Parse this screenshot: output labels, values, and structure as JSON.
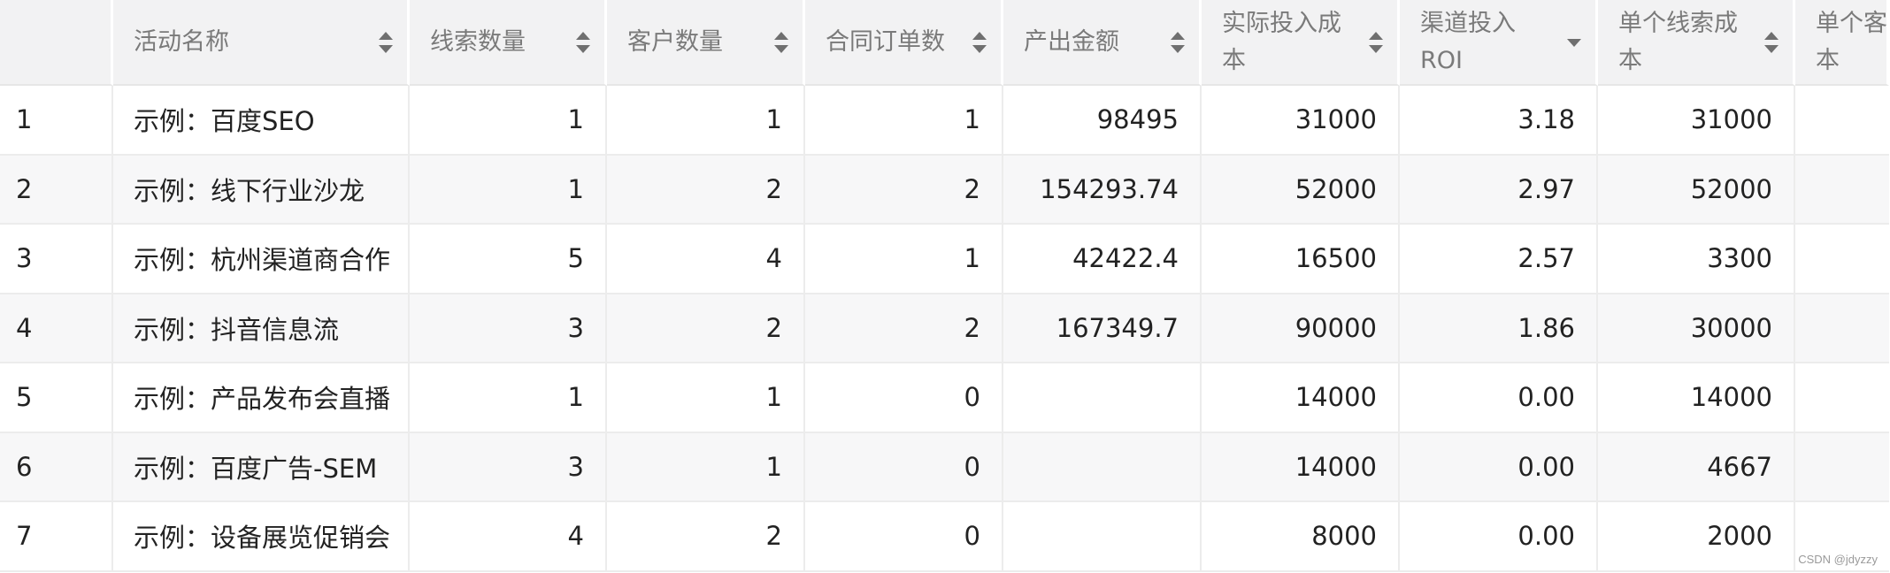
{
  "table": {
    "headers": [
      {
        "lines": [
          ""
        ],
        "sort": "none"
      },
      {
        "lines": [
          "活动名称"
        ],
        "sort": "both"
      },
      {
        "lines": [
          "线索数量"
        ],
        "sort": "both"
      },
      {
        "lines": [
          "客户数量"
        ],
        "sort": "both"
      },
      {
        "lines": [
          "合同订单数"
        ],
        "sort": "both"
      },
      {
        "lines": [
          "产出金额"
        ],
        "sort": "both"
      },
      {
        "lines": [
          "实际投入成",
          "本"
        ],
        "sort": "both"
      },
      {
        "lines": [
          "渠道投入",
          "ROI"
        ],
        "sort": "desc"
      },
      {
        "lines": [
          "单个线索成",
          "本"
        ],
        "sort": "both"
      },
      {
        "lines": [
          "单个客",
          "本"
        ],
        "sort": "none"
      }
    ],
    "rows": [
      [
        "1",
        "示例：百度SEO",
        "1",
        "1",
        "1",
        "98495",
        "31000",
        "3.18",
        "31000",
        ""
      ],
      [
        "2",
        "示例：线下行业沙龙",
        "1",
        "2",
        "2",
        "154293.74",
        "52000",
        "2.97",
        "52000",
        ""
      ],
      [
        "3",
        "示例：杭州渠道商合作",
        "5",
        "4",
        "1",
        "42422.4",
        "16500",
        "2.57",
        "3300",
        ""
      ],
      [
        "4",
        "示例：抖音信息流",
        "3",
        "2",
        "2",
        "167349.7",
        "90000",
        "1.86",
        "30000",
        ""
      ],
      [
        "5",
        "示例：产品发布会直播",
        "1",
        "1",
        "0",
        "",
        "14000",
        "0.00",
        "14000",
        ""
      ],
      [
        "6",
        "示例：百度广告-SEM",
        "3",
        "1",
        "0",
        "",
        "14000",
        "0.00",
        "4667",
        ""
      ],
      [
        "7",
        "示例：设备展览促销会",
        "4",
        "2",
        "0",
        "",
        "8000",
        "0.00",
        "2000",
        ""
      ]
    ]
  },
  "watermark": "CSDN @jdyzzy"
}
